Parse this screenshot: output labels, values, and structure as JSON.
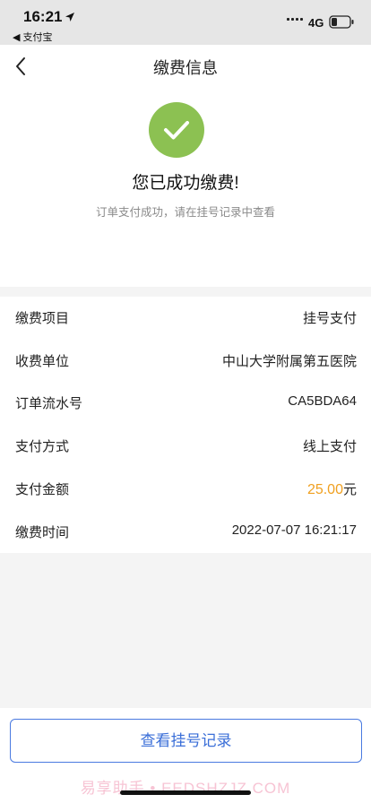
{
  "status_bar": {
    "time": "16:21",
    "back_app": "◀ 支付宝",
    "network": "4G"
  },
  "nav": {
    "title": "缴费信息"
  },
  "success": {
    "title": "您已成功缴费!",
    "subtitle": "订单支付成功，请在挂号记录中查看",
    "icon": "check-icon",
    "color": "#8cc152"
  },
  "details": [
    {
      "label": "缴费项目",
      "value": "挂号支付"
    },
    {
      "label": "收费单位",
      "value": "中山大学附属第五医院"
    },
    {
      "label": "订单流水号",
      "value": "CA5BDA64"
    },
    {
      "label": "支付方式",
      "value": "线上支付"
    },
    {
      "label": "支付金额",
      "amount": "25.00",
      "unit": "元"
    },
    {
      "label": "缴费时间",
      "value": "2022-07-07 16:21:17"
    }
  ],
  "button": {
    "label": "查看挂号记录"
  },
  "watermark": "易享助手 • EEDSHZJZ.COM",
  "colors": {
    "accent": "#3b6fd8",
    "amount": "#f0a020",
    "success": "#8cc152"
  }
}
